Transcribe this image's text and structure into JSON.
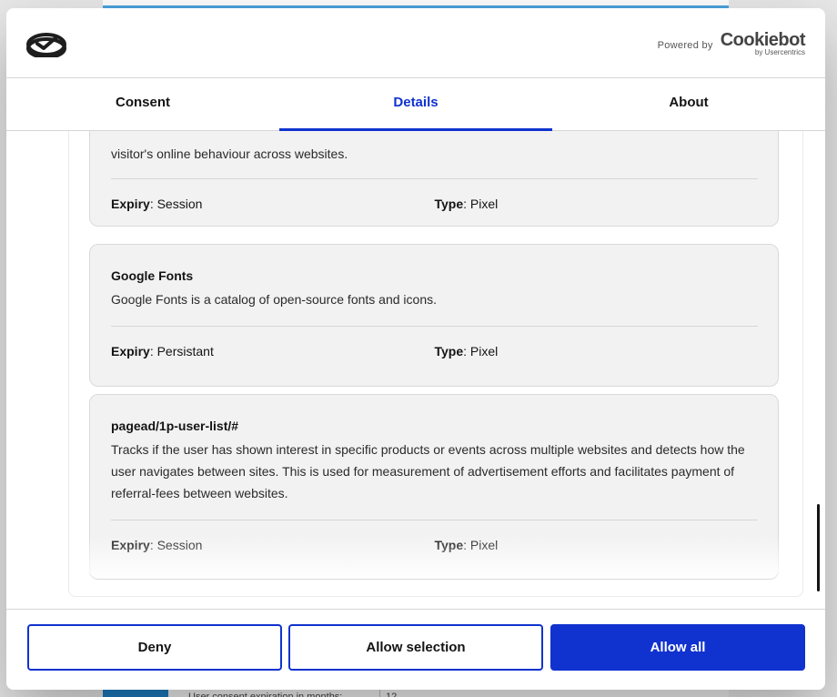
{
  "background": {
    "consent_expiry_label": "User consent expiration in months:",
    "consent_expiry_value": "12"
  },
  "header": {
    "powered_by": "Powered by",
    "brand_name": "Cookiebot",
    "brand_sub": "by Usercentrics"
  },
  "tabs": [
    {
      "label": "Consent",
      "active": false
    },
    {
      "label": "Details",
      "active": true
    },
    {
      "label": "About",
      "active": false
    }
  ],
  "cookies": [
    {
      "name": "",
      "description": "visitor's online behaviour across websites.",
      "expiry_label": "Expiry",
      "expiry_value": ": Session",
      "type_label": "Type",
      "type_value": ": Pixel"
    },
    {
      "name": "Google Fonts",
      "description": "Google Fonts is a catalog of open-source fonts and icons.",
      "expiry_label": "Expiry",
      "expiry_value": ": Persistant",
      "type_label": "Type",
      "type_value": ": Pixel"
    },
    {
      "name": "pagead/1p-user-list/#",
      "description": "Tracks if the user has shown interest in specific products or events across multiple websites and detects how the user navigates between sites. This is used for measurement of advertisement efforts and facilitates payment of referral-fees between websites.",
      "expiry_label": "Expiry",
      "expiry_value": ": Session",
      "type_label": "Type",
      "type_value": ": Pixel"
    }
  ],
  "footer": {
    "deny_label": "Deny",
    "allow_selection_label": "Allow selection",
    "allow_all_label": "Allow all"
  },
  "colors": {
    "accent": "#1032cf",
    "card_background": "#f2f2f2",
    "text": "#141414"
  }
}
